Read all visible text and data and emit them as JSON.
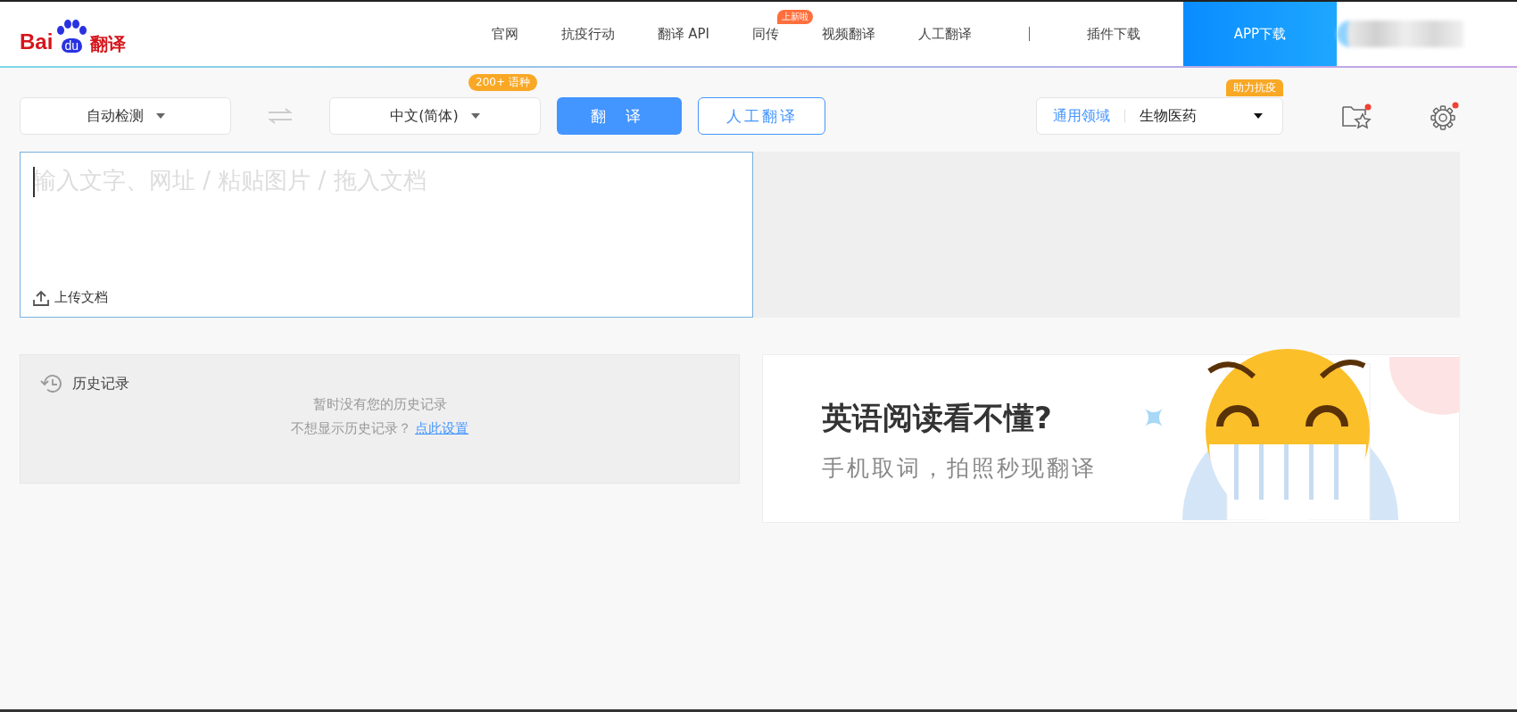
{
  "header": {
    "logo": {
      "brand": "Bai",
      "badge": "du",
      "product": "翻译"
    },
    "nav": [
      {
        "label": "官网"
      },
      {
        "label": "抗疫行动"
      },
      {
        "label": "翻译 API"
      },
      {
        "label": "同传",
        "badge": "上新啦"
      },
      {
        "label": "视频翻译"
      },
      {
        "label": "人工翻译"
      }
    ],
    "nav_after_divider": [
      {
        "label": "插件下载"
      }
    ],
    "app_button": "APP下载"
  },
  "toolbar": {
    "source_language": "自动检测",
    "target_language": "中文(简体)",
    "target_badge": "200+ 语种",
    "translate_button": "翻 译",
    "human_button": "人工翻译",
    "domain": {
      "label": "通用领域",
      "value": "生物医药",
      "badge": "助力抗疫"
    },
    "favorites": {
      "notification": true
    },
    "settings": {
      "notification": true
    }
  },
  "input": {
    "placeholder": "输入文字、网址 / 粘贴图片 / 拖入文档",
    "upload": "上传文档"
  },
  "history": {
    "title": "历史记录",
    "empty": "暂时没有您的历史记录",
    "hint": "不想显示历史记录？",
    "link": "点此设置"
  },
  "ad": {
    "title": "英语阅读看不懂?",
    "subtitle": "手机取词，拍照秒现翻译"
  }
}
